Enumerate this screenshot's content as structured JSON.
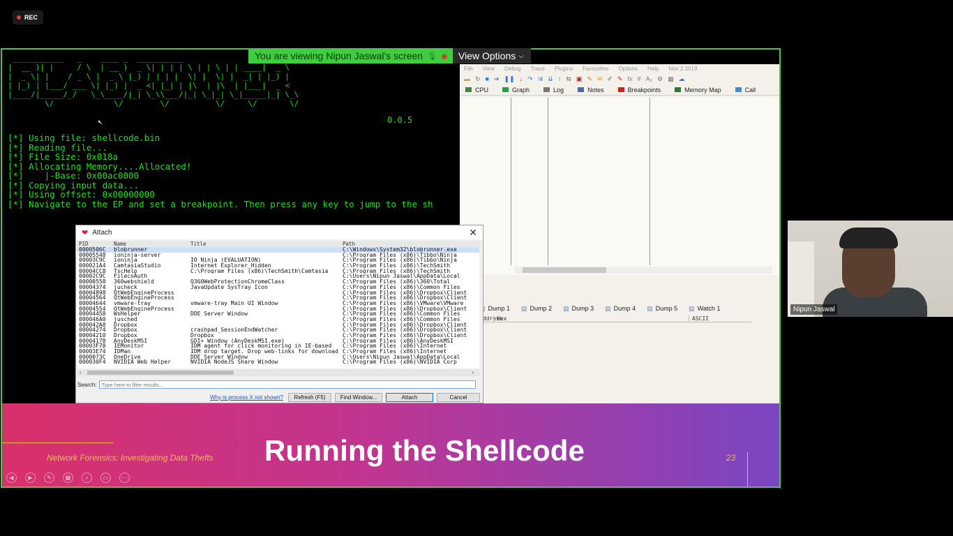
{
  "meeting": {
    "rec_label": "REC",
    "share_banner": "You are viewing Nipun Jaswal's screen",
    "view_options": "View Options",
    "participant_name": "Nipun Jaswal"
  },
  "terminal": {
    "banner_lines": [
      " ___________   _    ____ _  __________              _________",
      "|  __ )| |     / \\  | __ )  _ \\| | | | \\ | | \\ | | ____|  _ \\",
      "|  _ \\| |    / _ \\ |  _ \\ |_) | | | |  \\| |  \\| |  _| | |_) |",
      "| |_) | |___/ ___ \\| |_) |  _ <| |_| | |\\  | |\\  | |___|  _ <",
      "|____/|_____/_/   \\_\\____/|_| \\_\\\\___/|_| \\_|_| \\_|_____|_| \\_\\",
      "        \\/             \\/        \\/          \\/     \\/       \\/"
    ],
    "version": "0.0.5",
    "lines": [
      "[*] Using file: shellcode.bin",
      "[*] Reading file...",
      "[*] File Size: 0x018a",
      "[*] Allocating Memory....Allocated!",
      "[*]    |-Base: 0x00ac0000",
      "[*] Copying input data...",
      "[*] Using offset: 0x00000000",
      "[*] Navigate to the EP and set a breakpoint. Then press any key to jump to the sh"
    ]
  },
  "debugger": {
    "menu": [
      "File",
      "View",
      "Debug",
      "Trace",
      "Plugins",
      "Favourites",
      "Options",
      "Help",
      "Nov 2 2019"
    ],
    "tabs": [
      {
        "label": "CPU",
        "icon": "cpu-icon",
        "color": "#3a8a3a"
      },
      {
        "label": "Graph",
        "icon": "graph-icon",
        "color": "#2a9a4a"
      },
      {
        "label": "Log",
        "icon": "log-icon",
        "color": "#777777"
      },
      {
        "label": "Notes",
        "icon": "notes-icon",
        "color": "#4a6aaa"
      },
      {
        "label": "Breakpoints",
        "icon": "breakpoint-icon",
        "color": "#d02020"
      },
      {
        "label": "Memory Map",
        "icon": "memory-map-icon",
        "color": "#2a7a2a"
      },
      {
        "label": "Call",
        "icon": "call-icon",
        "color": "#4a8ad0"
      }
    ],
    "dump_tabs": [
      "Dump 1",
      "Dump 2",
      "Dump 3",
      "Dump 4",
      "Dump 5",
      "Watch 1"
    ],
    "dump_columns": [
      "Address",
      "Hex",
      "ASCII"
    ]
  },
  "attach_dialog": {
    "title": "Attach",
    "columns": [
      "PID",
      "Name",
      "Title",
      "Path"
    ],
    "processes": [
      [
        "0000506C",
        "blobrunner",
        "",
        "C:\\Windows\\System32\\blobrunner.exe"
      ],
      [
        "00005548",
        "ioninja-server",
        "",
        "C:\\Program Files (x86)\\Tibbo\\Ninja"
      ],
      [
        "00003C9C",
        "ioninja",
        "IO Ninja (EVALUATION)",
        "C:\\Program Files (x86)\\Tibbo\\Ninja"
      ],
      [
        "000021A4",
        "CamtasiaStudio",
        "Internet Explorer_Hidden",
        "C:\\Program Files (x86)\\TechSmith"
      ],
      [
        "00004CC8",
        "TscHelp",
        "C:\\Program Files (x86)\\TechSmith\\Camtasia",
        "C:\\Program Files (x86)\\TechSmith"
      ],
      [
        "00002C9C",
        "FilecoAuth",
        "",
        "C:\\Users\\Nipun Jaswal\\AppData\\Local"
      ],
      [
        "00000558",
        "360webshield",
        "Q360WebProtectionChromeClass",
        "C:\\Program Files (x86)\\360\\Total"
      ],
      [
        "00004374",
        "jucheck",
        "JavaUpdate SysTray Icon",
        "C:\\Program Files (x86)\\Common Files"
      ],
      [
        "00004898",
        "QtWebEngineProcess",
        "",
        "C:\\Program Files (x86)\\Dropbox\\Client"
      ],
      [
        "00004564",
        "QtWebEngineProcess",
        "",
        "C:\\Program Files (x86)\\Dropbox\\Client"
      ],
      [
        "00004644",
        "vmware-tray",
        "vmware-tray Main UI Window",
        "C:\\Program Files (x86)\\VMware\\VMware"
      ],
      [
        "00004554",
        "QtWebEngineProcess",
        "",
        "C:\\Program Files (x86)\\Dropbox\\Client"
      ],
      [
        "00004458",
        "WsHelper",
        "DDE Server Window",
        "C:\\Program Files (x86)\\Common Files"
      ],
      [
        "000046A0",
        "jusched",
        "",
        "C:\\Program Files (x86)\\Common Files"
      ],
      [
        "000042A8",
        "Dropbox",
        "",
        "C:\\Program Files (x86)\\Dropbox\\Client"
      ],
      [
        "00004274",
        "Dropbox",
        "crashpad_SessionEndWatcher",
        "C:\\Program Files (x86)\\Dropbox\\Client"
      ],
      [
        "00004210",
        "Dropbox",
        "Dropbox",
        "C:\\Program Files (x86)\\Dropbox\\Client"
      ],
      [
        "00004178",
        "AnyDeskMSI",
        "GDI+ Window (AnyDeskMSI.exe)",
        "C:\\Program Files (x86)\\AnyDeskMSI"
      ],
      [
        "00003F78",
        "IEMonitor",
        "IDM agent for click monitoring in IE-based",
        "C:\\Program Files (x86)\\Internet"
      ],
      [
        "00003E74",
        "IDMan",
        "IDM drop target. Drop web-links for download",
        "C:\\Program Files (x86)\\Internet"
      ],
      [
        "0000073C",
        "OneDrive",
        "DDE Server Window",
        "C:\\Users\\Nipun Jaswal\\AppData\\Local"
      ],
      [
        "000030F4",
        "NVIDIA Web Helper",
        "NVIDIA NodeJS Share Window",
        "C:\\Program Files (x86)\\NVIDIA Corp"
      ]
    ],
    "search_label": "Search:",
    "search_placeholder": "Type here to filter results...",
    "why_link": "Why is process X not shown?",
    "buttons": {
      "refresh": "Refresh (F5)",
      "find_window": "Find Window...",
      "attach": "Attach",
      "cancel": "Cancel"
    }
  },
  "slide": {
    "title": "Running the Shellcode",
    "subtitle": "Network Forensics: Investigating Data Thefts",
    "page_number": "23"
  },
  "colors": {
    "share_border": "#3fcd3f",
    "terminal_text": "#1ee01e",
    "slide_accent": "#f0c040"
  }
}
